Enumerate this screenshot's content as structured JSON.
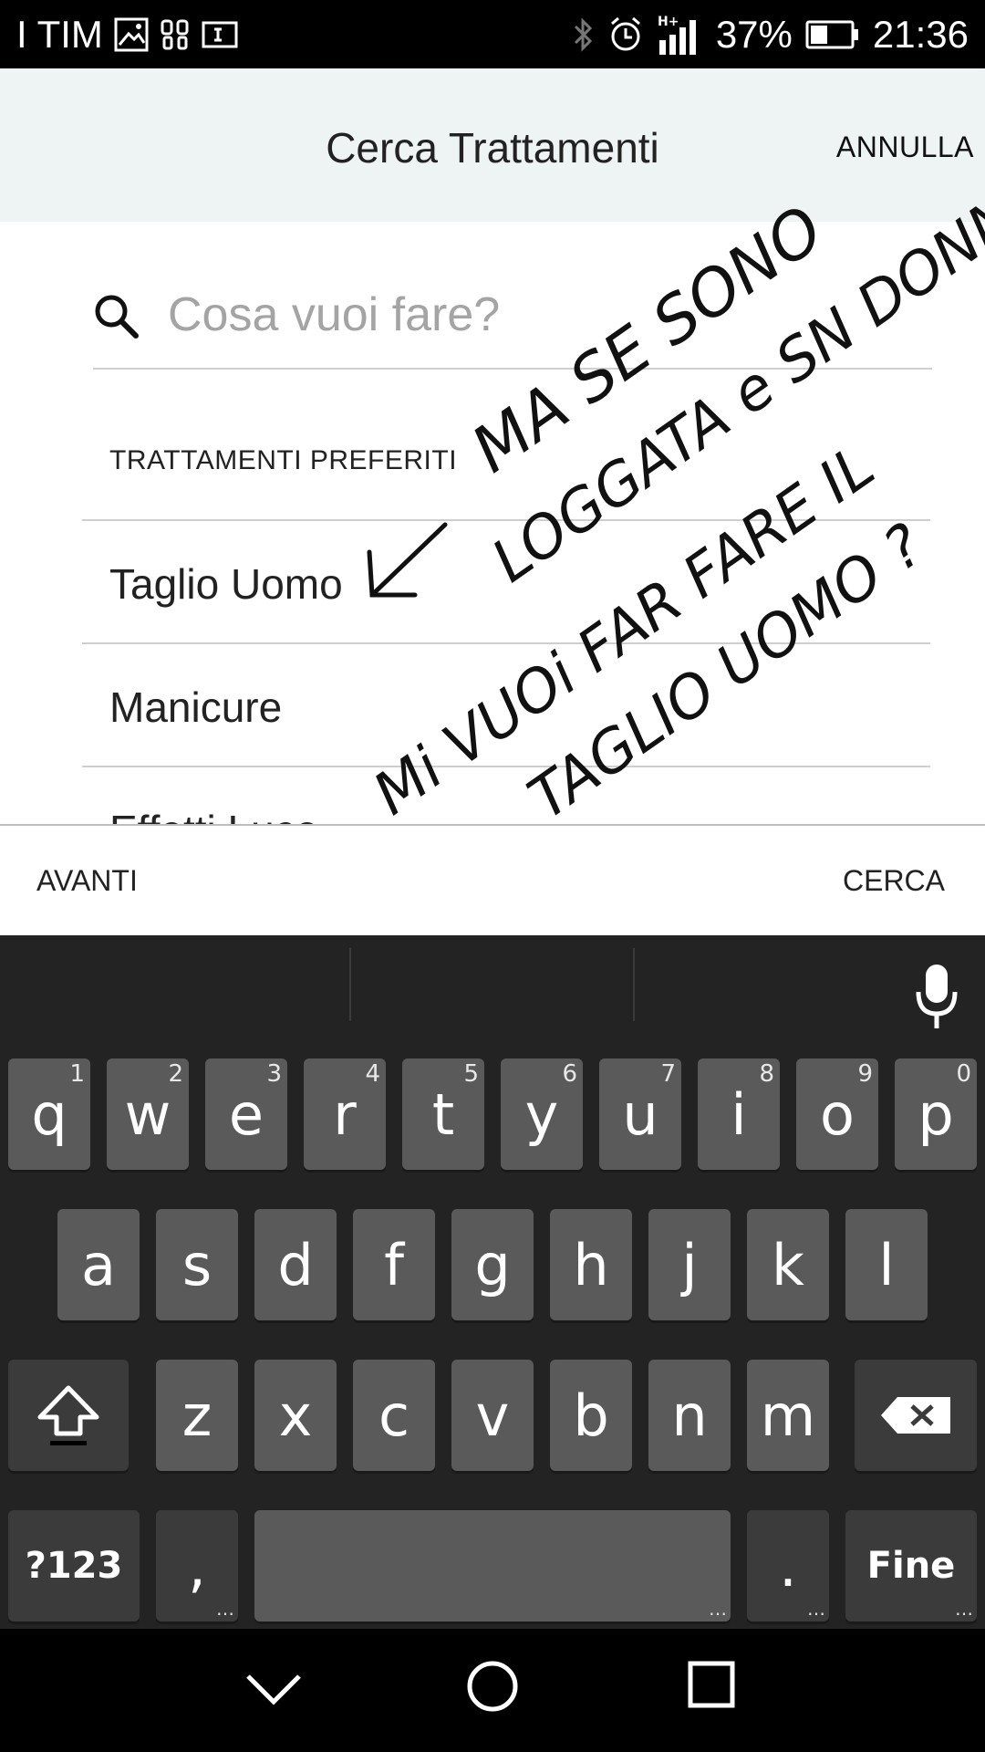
{
  "status_bar": {
    "carrier": "I TIM",
    "network": "H+",
    "battery_percent": "37%",
    "time": "21:36",
    "icons": [
      "gallery-icon",
      "voicemail-icon",
      "sim-icon",
      "bluetooth-icon",
      "alarm-icon",
      "signal-icon",
      "battery-icon"
    ]
  },
  "header": {
    "title": "Cerca Trattamenti",
    "cancel_label": "ANNULLA"
  },
  "search": {
    "placeholder": "Cosa vuoi fare?",
    "value": ""
  },
  "favorites": {
    "section_title": "TRATTAMENTI PREFERITI",
    "items": [
      "Taglio Uomo",
      "Manicure",
      "Effetti Luce"
    ]
  },
  "action_bar": {
    "next_label": "AVANTI",
    "search_label": "CERCA"
  },
  "handwritten_note": {
    "lines": [
      "MA SE SONO",
      "LOGGATA e SN DONNA",
      "Mi VUOi FAR FARE IL",
      "TAGLIO UOMO ?"
    ]
  },
  "keyboard": {
    "row1": [
      {
        "key": "q",
        "hint": "1"
      },
      {
        "key": "w",
        "hint": "2"
      },
      {
        "key": "e",
        "hint": "3"
      },
      {
        "key": "r",
        "hint": "4"
      },
      {
        "key": "t",
        "hint": "5"
      },
      {
        "key": "y",
        "hint": "6"
      },
      {
        "key": "u",
        "hint": "7"
      },
      {
        "key": "i",
        "hint": "8"
      },
      {
        "key": "o",
        "hint": "9"
      },
      {
        "key": "p",
        "hint": "0"
      }
    ],
    "row2": [
      "a",
      "s",
      "d",
      "f",
      "g",
      "h",
      "j",
      "k",
      "l"
    ],
    "row3": [
      "z",
      "x",
      "c",
      "v",
      "b",
      "n",
      "m"
    ],
    "symbols_label": "?123",
    "comma": ",",
    "period": ".",
    "done_label": "Fine"
  },
  "colors": {
    "header_bg": "#eef4f4",
    "keyboard_bg": "#232323",
    "key_bg": "#5a5a5a",
    "key_fn_bg": "#3b3b3b"
  }
}
